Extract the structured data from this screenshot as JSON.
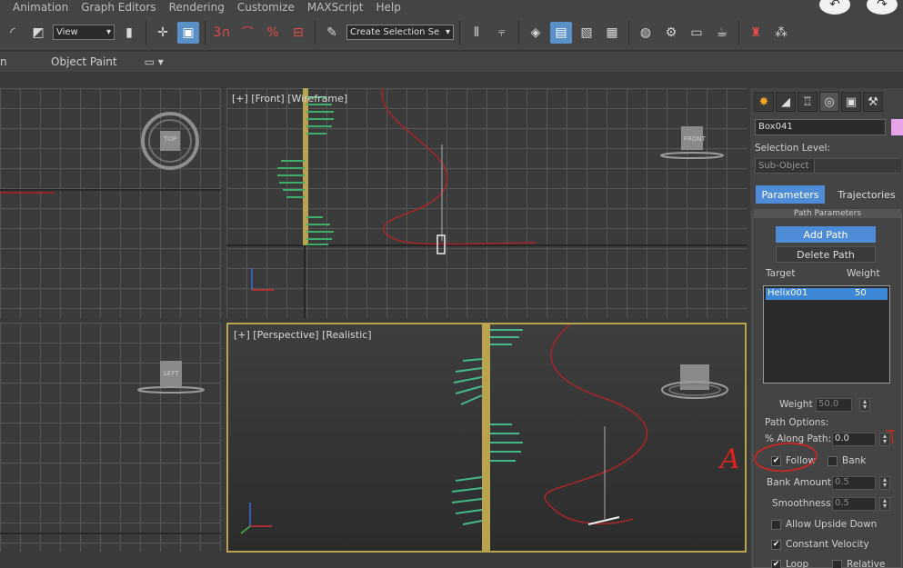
{
  "menu": [
    "Animation",
    "Graph Editors",
    "Rendering",
    "Customize",
    "MAXScript",
    "Help"
  ],
  "toolbar": {
    "view_dropdown": "View",
    "selection_set": "Create Selection Se",
    "snap3": "3",
    "angle": "Ⓐ",
    "percent": "%",
    "spinner_snap": "⊞"
  },
  "ribbon": {
    "left_fragment": "n",
    "object_paint": "Object Paint"
  },
  "viewports": {
    "front": "[+] [Front] [Wireframe]",
    "perspective": "[+] [Perspective] [Realistic]",
    "viewcube_top": "TOP",
    "viewcube_front": "FRONT",
    "viewcube_left": "LEFT"
  },
  "panel": {
    "object_name": "Box041",
    "object_color": "#e7a3e7",
    "selection_level_label": "Selection Level:",
    "sub_object": "Sub-Object",
    "tab_parameters": "Parameters",
    "tab_trajectories": "Trajectories",
    "rollout_title": "Path Parameters",
    "add_path": "Add Path",
    "delete_path": "Delete Path",
    "target_header": "Target",
    "weight_header": "Weight",
    "target_row": {
      "name": "Helix001",
      "weight": "50"
    },
    "weight_label": "Weight",
    "weight_value": "50.0",
    "path_options_label": "Path Options:",
    "along_path_label": "% Along Path:",
    "along_path_value": "0.0",
    "follow_label": "Follow",
    "follow_checked": true,
    "bank_label": "Bank",
    "bank_checked": false,
    "bank_amount_label": "Bank Amount:",
    "bank_amount_value": "0.5",
    "smoothness_label": "Smoothness:",
    "smoothness_value": "0.5",
    "allow_upside_down_label": "Allow Upside Down",
    "constant_velocity_label": "Constant Velocity",
    "constant_velocity_checked": true,
    "loop_label": "Loop",
    "relative_label": "Relative"
  },
  "annotation": {
    "letter": "A",
    "color": "#e0221c"
  }
}
